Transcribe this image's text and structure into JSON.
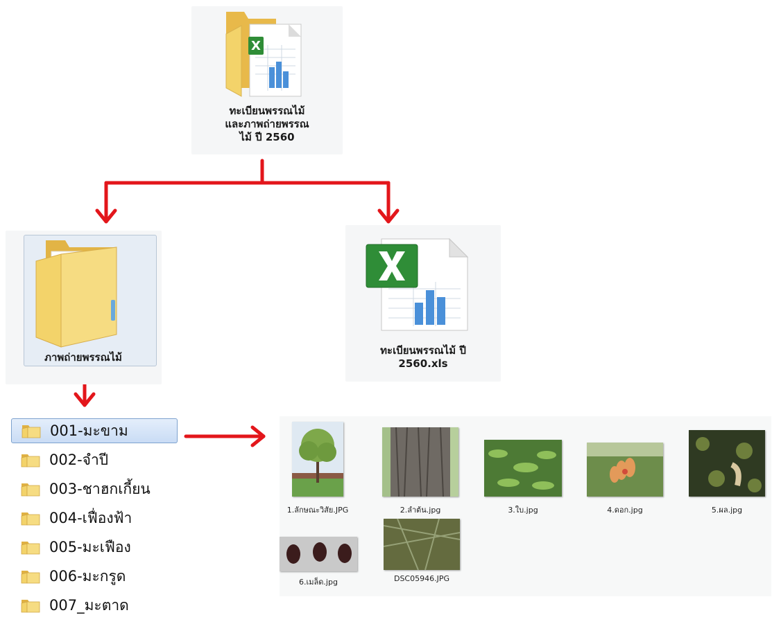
{
  "nodes": {
    "root": {
      "label_lines": [
        "ทะเบียนพรรณไม้",
        "และภาพถ่ายพรรณ",
        "ไม้ ปี 2560"
      ]
    },
    "photos_folder": {
      "label": "ภาพถ่ายพรรณไม้"
    },
    "excel_file": {
      "label_lines": [
        "ทะเบียนพรรณไม้ ปี",
        "2560.xls"
      ]
    }
  },
  "folders": [
    {
      "label": "001-มะขาม",
      "selected": true
    },
    {
      "label": "002-จำปี",
      "selected": false
    },
    {
      "label": "003-ชาฮกเกี้ยน",
      "selected": false
    },
    {
      "label": "004-เฟื่องฟ้า",
      "selected": false
    },
    {
      "label": "005-มะเฟือง",
      "selected": false
    },
    {
      "label": "006-มะกรูด",
      "selected": false
    },
    {
      "label": "007_มะตาด",
      "selected": false
    }
  ],
  "photos": [
    {
      "label": "1.ลักษณะวิสัย.JPG",
      "subject": "tree"
    },
    {
      "label": "2.ลำต้น.jpg",
      "subject": "bark"
    },
    {
      "label": "3.ใบ.jpg",
      "subject": "leaves"
    },
    {
      "label": "4.ดอก.jpg",
      "subject": "flower"
    },
    {
      "label": "5.ผล.jpg",
      "subject": "fruit"
    },
    {
      "label": "6.เมล็ด.jpg",
      "subject": "seeds"
    },
    {
      "label": "DSC05946.JPG",
      "subject": "canopy"
    }
  ],
  "colors": {
    "arrow": "#e3161b",
    "folder": "#f3d36a",
    "excel_green": "#2f8d37",
    "selection": "#c9dcf5"
  }
}
